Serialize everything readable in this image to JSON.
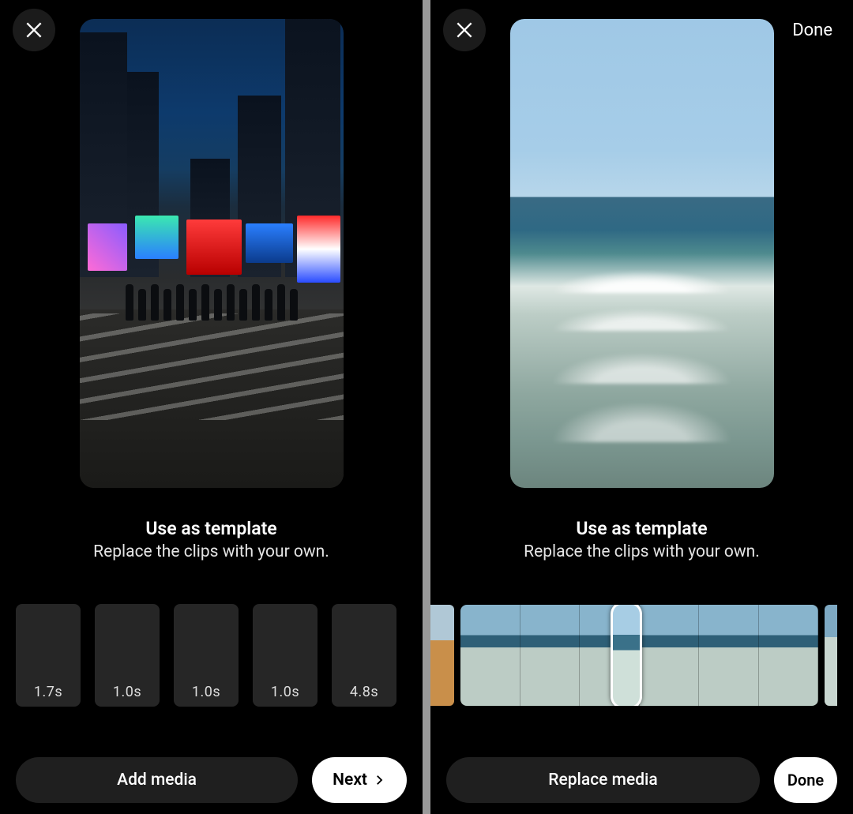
{
  "left": {
    "close_label": "Close",
    "title": "Use as template",
    "subtitle": "Replace the clips with your own.",
    "clips": [
      {
        "duration": "1.7s"
      },
      {
        "duration": "1.0s"
      },
      {
        "duration": "1.0s"
      },
      {
        "duration": "1.0s"
      },
      {
        "duration": "4.8s"
      }
    ],
    "add_media": "Add media",
    "next": "Next"
  },
  "right": {
    "close_label": "Close",
    "done_top": "Done",
    "title": "Use as template",
    "subtitle": "Replace the clips with your own.",
    "replace_media": "Replace media",
    "done_bottom": "Done"
  }
}
